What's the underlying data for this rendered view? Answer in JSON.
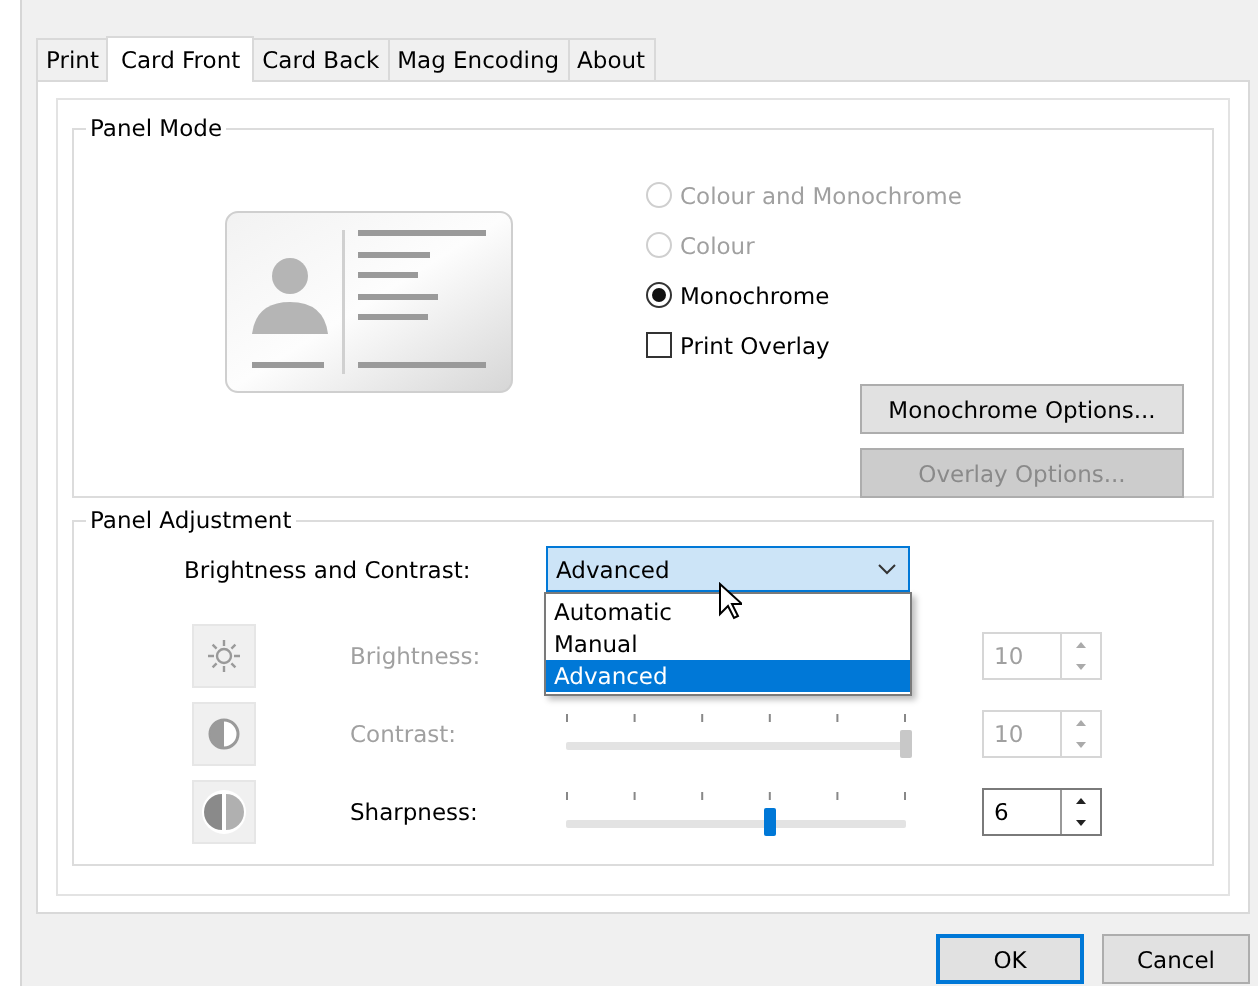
{
  "tabs": [
    {
      "label": "Print",
      "selected": false
    },
    {
      "label": "Card Front",
      "selected": true
    },
    {
      "label": "Card Back",
      "selected": false
    },
    {
      "label": "Mag Encoding",
      "selected": false
    },
    {
      "label": "About",
      "selected": false
    }
  ],
  "panel_mode": {
    "title": "Panel Mode",
    "options": [
      {
        "kind": "radio",
        "label": "Colour and Monochrome",
        "selected": false,
        "disabled": true
      },
      {
        "kind": "radio",
        "label": "Colour",
        "selected": false,
        "disabled": true
      },
      {
        "kind": "radio",
        "label": "Monochrome",
        "selected": true,
        "disabled": false
      },
      {
        "kind": "checkbox",
        "label": "Print Overlay",
        "checked": false,
        "disabled": false
      }
    ],
    "buttons": [
      {
        "label": "Monochrome Options...",
        "disabled": false
      },
      {
        "label": "Overlay Options...",
        "disabled": true
      }
    ]
  },
  "panel_adjustment": {
    "title": "Panel Adjustment",
    "mode": {
      "label": "Brightness and Contrast:",
      "value": "Advanced",
      "expanded": true,
      "options": [
        {
          "label": "Automatic",
          "selected": false
        },
        {
          "label": "Manual",
          "selected": false
        },
        {
          "label": "Advanced",
          "selected": true
        }
      ]
    },
    "settings": [
      {
        "label": "Brightness:",
        "disabled": true,
        "value": "10"
      },
      {
        "label": "Contrast:",
        "disabled": true,
        "level": 1,
        "value": "10"
      },
      {
        "label": "Sharpness:",
        "disabled": false,
        "level": 0.6,
        "value": "6"
      }
    ]
  },
  "buttons": [
    {
      "label": "OK",
      "default": true
    },
    {
      "label": "Cancel",
      "default": false
    }
  ]
}
